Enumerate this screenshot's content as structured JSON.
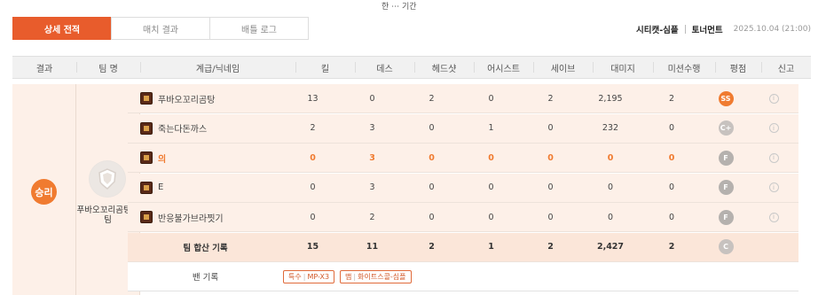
{
  "top_fragment": "한 ⋯ 기간",
  "tabs": [
    {
      "label": "상세 전적",
      "active": true
    },
    {
      "label": "매치 결과",
      "active": false
    },
    {
      "label": "배틀 로그",
      "active": false
    }
  ],
  "match": {
    "map": "시티캣-심플",
    "mode": "토너먼트",
    "date": "2025.10.04 (21:00)"
  },
  "columns": [
    "결과",
    "팀 명",
    "계급/닉네임",
    "킬",
    "데스",
    "헤드샷",
    "어시스트",
    "세이브",
    "대미지",
    "미션수행",
    "평점",
    "신고"
  ],
  "result_label": "승리",
  "team_name": "푸바오꼬리곰탕의 팀",
  "players": [
    {
      "name": "푸바오꼬리곰탕",
      "kill": "13",
      "death": "0",
      "head": "2",
      "assist": "0",
      "save": "2",
      "damage": "2,195",
      "mission": "2",
      "grade": "SS",
      "highlight": false
    },
    {
      "name": "죽는다돈까스",
      "kill": "2",
      "death": "3",
      "head": "0",
      "assist": "1",
      "save": "0",
      "damage": "232",
      "mission": "0",
      "grade": "C+",
      "highlight": false
    },
    {
      "name": "의",
      "kill": "0",
      "death": "3",
      "head": "0",
      "assist": "0",
      "save": "0",
      "damage": "0",
      "mission": "0",
      "grade": "F",
      "highlight": true
    },
    {
      "name": "E",
      "kill": "0",
      "death": "3",
      "head": "0",
      "assist": "0",
      "save": "0",
      "damage": "0",
      "mission": "0",
      "grade": "F",
      "highlight": false
    },
    {
      "name": "반응불가브라찟기",
      "kill": "0",
      "death": "2",
      "head": "0",
      "assist": "0",
      "save": "0",
      "damage": "0",
      "mission": "0",
      "grade": "F",
      "highlight": false
    }
  ],
  "total": {
    "label": "팀 합산 기록",
    "kill": "15",
    "death": "11",
    "head": "2",
    "assist": "1",
    "save": "2",
    "damage": "2,427",
    "mission": "2",
    "grade": "C"
  },
  "ban": {
    "label": "밴 기록",
    "chips": [
      {
        "type": "특수",
        "value": "MP-X3"
      },
      {
        "type": "맵",
        "value": "화이트스콜-심플"
      }
    ]
  },
  "colors": {
    "accent": "#e85c2c",
    "row_bg": "#fdf0e8",
    "grade_ss": "#f07b30",
    "grade_f": "#b5b1ae"
  }
}
